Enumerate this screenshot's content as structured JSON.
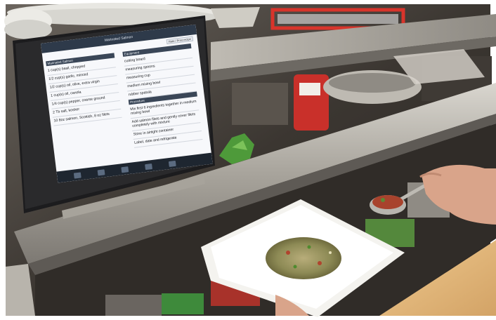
{
  "photo": {
    "subject": "restaurant kitchen pass",
    "colors": {
      "steel": "#8c8a86",
      "steel_light": "#c9c6c0",
      "counter": "#e0b77c",
      "tablet": "#1c1c1e",
      "plate": "#f4f3ef",
      "food": "#a9a070",
      "background": "#3a3632"
    }
  },
  "tablet": {
    "title": "Marinated Salmon",
    "top_button": "Rate / Print recipe",
    "ingredients_header": "Marinated Salmon",
    "ingredients": [
      "1 cup(s) basil, chopped",
      "1/2 cup(s) garlic, minced",
      "1/2 cup(s) oil, olive, extra virgin",
      "1 cup(s) oil, canola",
      "1/4 cup(s) pepper, coarse ground",
      "2 Tb salt, kosher",
      "10 8oz salmon, Scottish, 8 oz filets"
    ],
    "equipment_header": "Equipment",
    "equipment": [
      "cutting board",
      "measuring spoons",
      "measuring cup",
      "medium mixing bowl",
      "rubber spatula"
    ],
    "method_header": "Procedure",
    "method": [
      "Mix first 6 ingredients together in medium mixing bowl",
      "Add salmon filets and gently cover filets completely with mixture",
      "Store in airtight container",
      "Label, date and refrigerate"
    ],
    "dock_icons": [
      "home-icon",
      "recipes-icon",
      "search-icon",
      "list-icon",
      "settings-icon"
    ]
  }
}
